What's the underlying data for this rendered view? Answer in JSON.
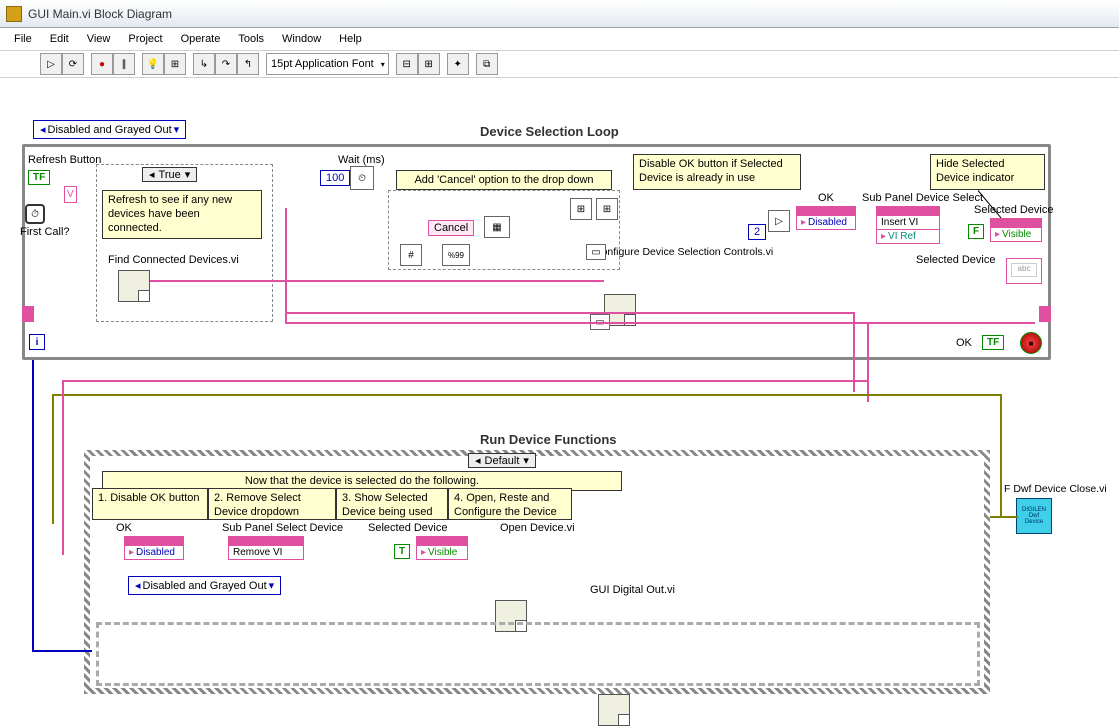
{
  "window": {
    "title": "GUI Main.vi Block Diagram"
  },
  "menu": {
    "file": "File",
    "edit": "Edit",
    "view": "View",
    "project": "Project",
    "operate": "Operate",
    "tools": "Tools",
    "window": "Window",
    "help": "Help"
  },
  "toolbar": {
    "font": "15pt Application Font"
  },
  "tags": {
    "disabled_grayed": "Disabled and Grayed Out",
    "disabled_grayed2": "Disabled and Grayed Out"
  },
  "loop1": {
    "title": "Device Selection Loop",
    "refresh_label": "Refresh Button",
    "first_call": "First Call?",
    "refresh_comment": "Refresh to see if any new devices have been connected.",
    "find_vi": "Find Connected Devices.vi",
    "case_true": "True",
    "wait_label": "Wait (ms)",
    "wait_ms": "100",
    "add_cancel_comment": "Add  'Cancel' option to the drop down",
    "cancel_str": "Cancel",
    "disable_ok_comment": "Disable OK button if Selected Device is already in use",
    "ok_label": "OK",
    "two": "2",
    "disabled_prop": "Disabled",
    "configure_vi": "Configure Device Selection Controls.vi",
    "subpanel_label": "Sub Panel Device Select",
    "insert_vi": "Insert VI",
    "vi_ref": "VI Ref",
    "hide_comment": "Hide Selected Device indicator",
    "selected_device": "Selected Device",
    "visible_prop": "Visible",
    "false_const": "F",
    "selected_device2": "Selected Device",
    "ok_out": "OK",
    "tf_out": "TF",
    "tf_in": "TF"
  },
  "loop2": {
    "title": "Run Device Functions",
    "case_default": "Default",
    "banner": "Now that the device is selected do the following.",
    "step1": "1. Disable OK button",
    "step2": "2. Remove Select Device dropdown",
    "step3": "3. Show Selected Device  being used",
    "step4": "4. Open, Reste and Configure the Device",
    "ok_label": "OK",
    "disabled_prop": "Disabled",
    "subpanel_label": "Sub Panel Select Device",
    "remove_vi": "Remove VI",
    "selected_device": "Selected Device",
    "true_const": "T",
    "visible_prop": "Visible",
    "open_vi": "Open Device.vi",
    "gui_do_vi": "GUI Digital Out.vi"
  },
  "close_vi": "F Dwf Device Close.vi"
}
